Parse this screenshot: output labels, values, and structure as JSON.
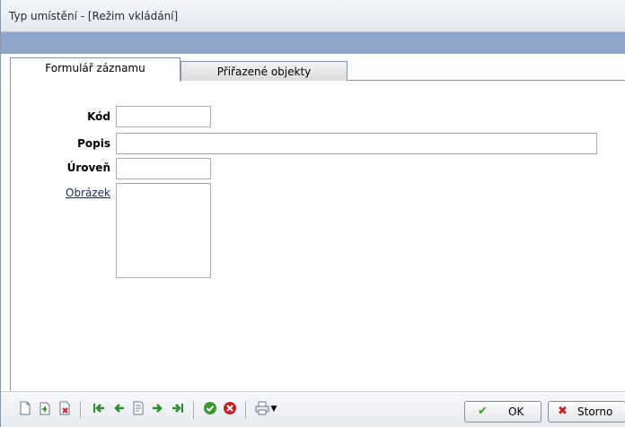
{
  "window": {
    "title": "Typ umístění - [Režim vkládání]"
  },
  "tabs": [
    {
      "label": "Formulář záznamu",
      "active": true
    },
    {
      "label": "Přiřazené objekty",
      "active": false
    }
  ],
  "form": {
    "kod_label": "Kód",
    "kod_value": "",
    "popis_label": "Popis",
    "popis_value": "",
    "uroven_label": "Úroveň",
    "uroven_value": "",
    "obrazek_label": "Obrázek"
  },
  "toolbar": {
    "icons": [
      "new-record-icon",
      "copy-record-icon",
      "delete-record-icon",
      "first-record-icon",
      "previous-record-icon",
      "find-record-icon",
      "next-record-icon",
      "last-record-icon",
      "confirm-icon",
      "cancel-icon",
      "print-icon"
    ],
    "ok_label": "OK",
    "storno_label": "Storno"
  },
  "colors": {
    "title_band": "#8ea6c9",
    "accent_ok": "#3a9a2c",
    "accent_cancel": "#c8202a"
  }
}
